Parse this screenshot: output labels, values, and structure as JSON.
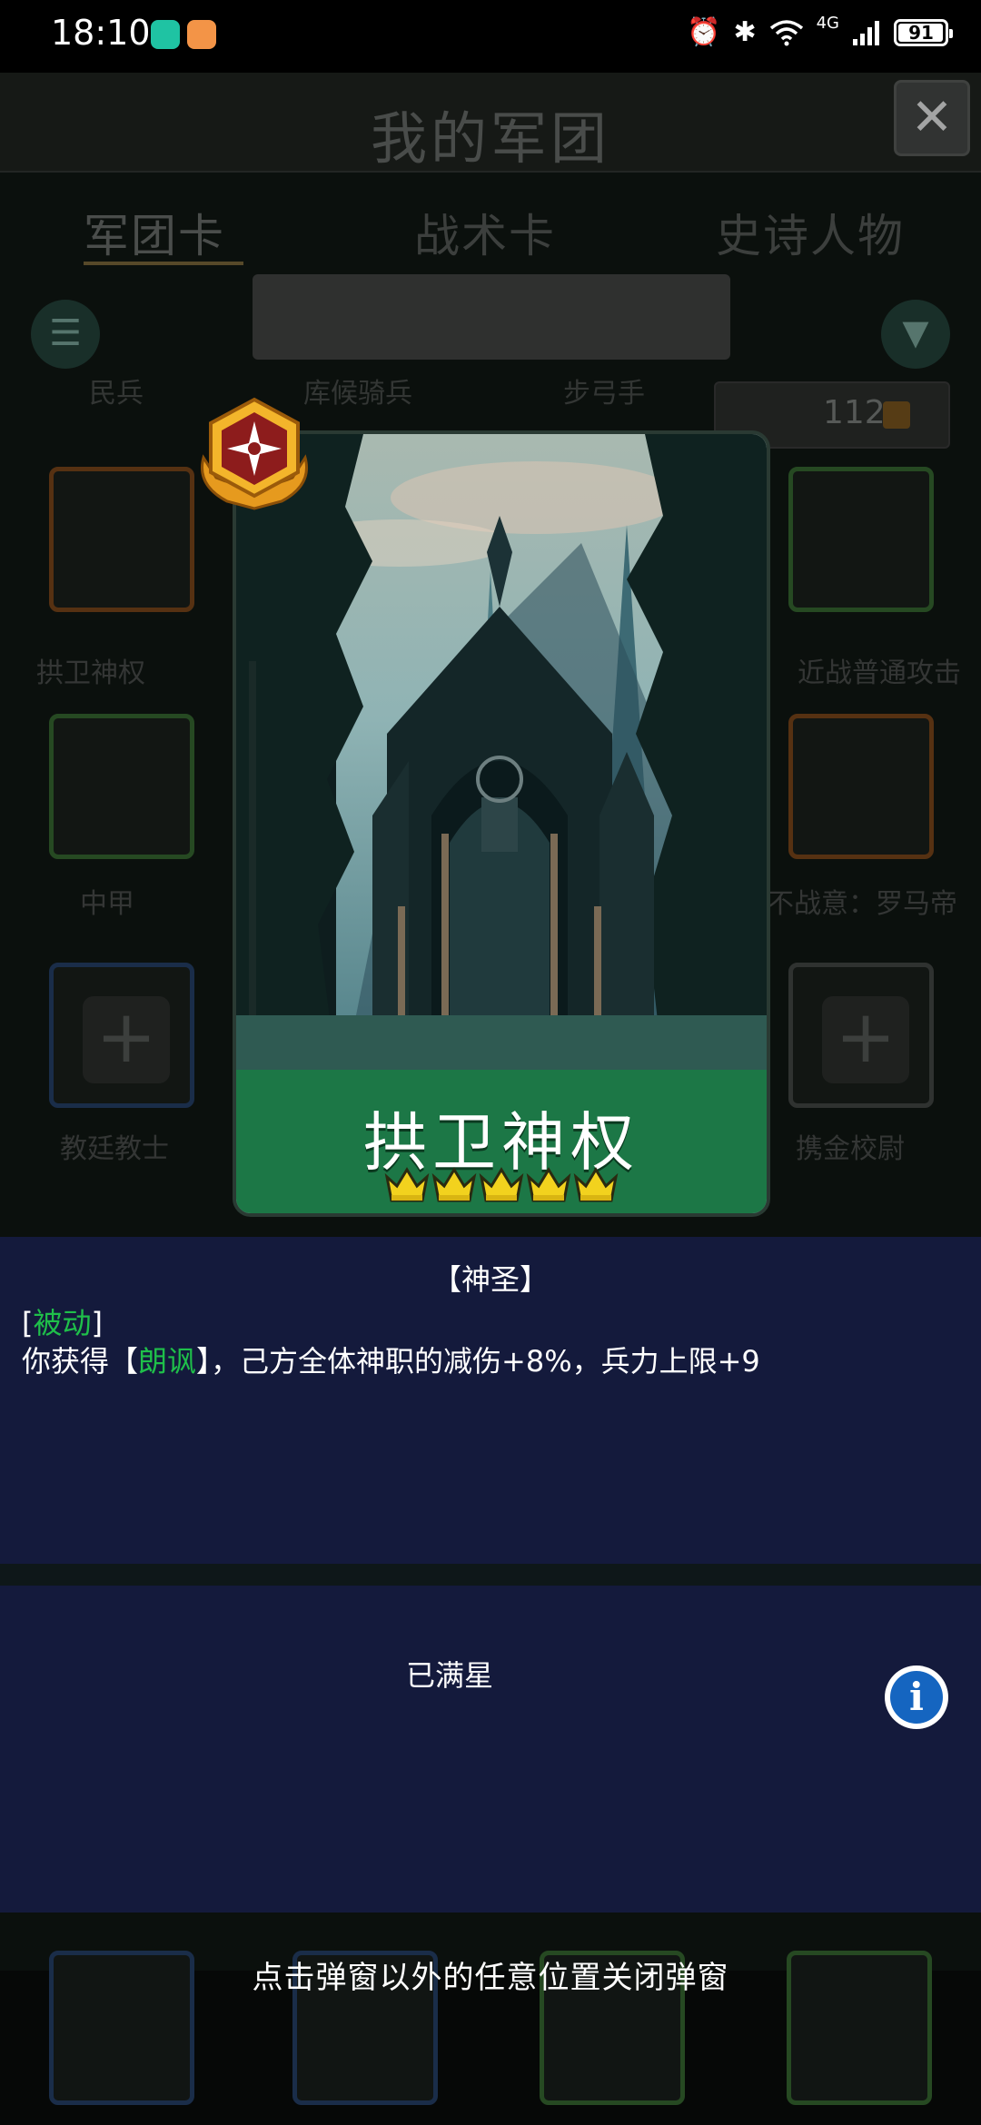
{
  "status_bar": {
    "time": "18:10",
    "network": "4G",
    "battery": "91",
    "icons": [
      "alarm-icon",
      "bluetooth-icon",
      "wifi-icon",
      "signal-icon"
    ]
  },
  "background": {
    "title": "我的军团",
    "tabs": [
      "军团卡",
      "战术卡",
      "史诗人物"
    ],
    "small_labels": [
      "民兵",
      "库候骑兵",
      "步弓手"
    ],
    "counter": "112",
    "card_labels": [
      "拱卫神权",
      "近战普通攻击",
      "中甲",
      "不战意：罗马帝",
      "教廷教士",
      "携金校尉"
    ]
  },
  "card": {
    "name": "拱卫神权",
    "stars": 5,
    "rarity": "epic"
  },
  "description": {
    "category": "【神圣】",
    "type_prefix": "[",
    "type": "被动",
    "type_suffix": "]",
    "text_part1": "你获得【",
    "skill": "朗讽",
    "text_part2": "】，己方全体神职的减伤+8%，兵力上限+9"
  },
  "star": {
    "status": "已满星"
  },
  "hint": "点击弹窗以外的任意位置关闭弹窗",
  "colors": {
    "panel_bg": "#141a3c",
    "card_band": "#1c7746",
    "accent_green": "#1fbf4a",
    "crown_gold": "#f2d21e"
  }
}
